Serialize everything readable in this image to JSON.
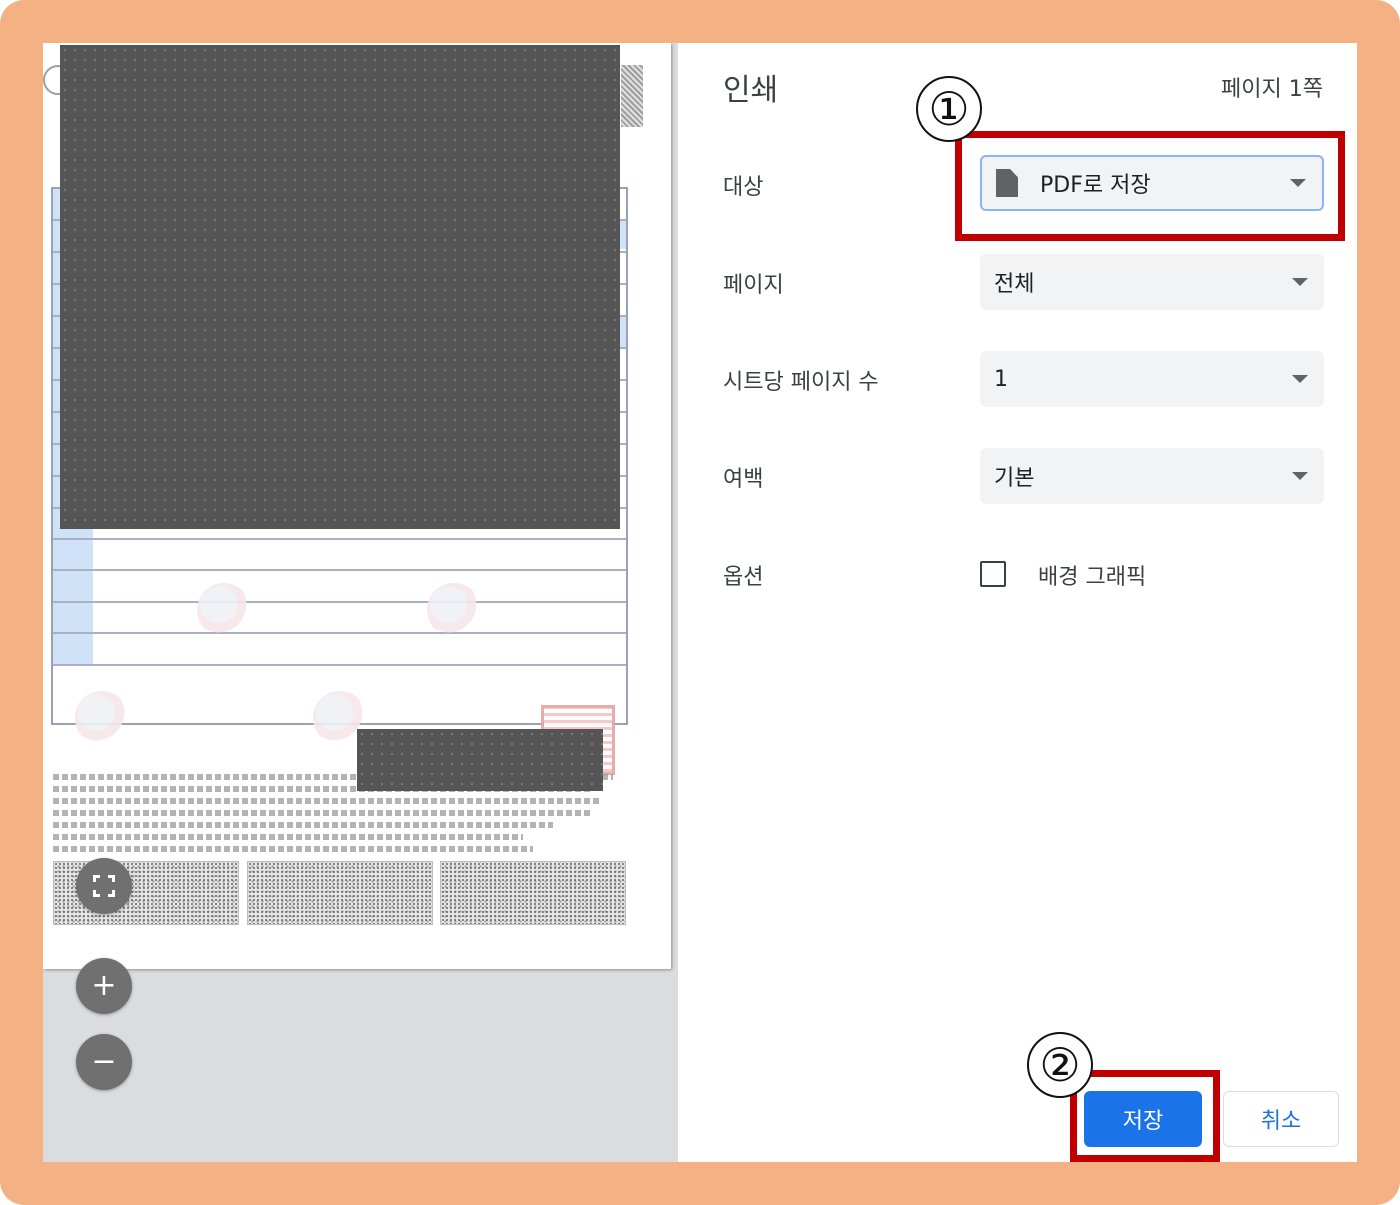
{
  "dialog": {
    "title": "인쇄",
    "page_count": "페이지 1쪽"
  },
  "settings": {
    "destination": {
      "label": "대상",
      "value": "PDF로 저장",
      "icon": "document-icon"
    },
    "pages": {
      "label": "페이지",
      "value": "전체"
    },
    "pages_per_sheet": {
      "label": "시트당 페이지 수",
      "value": "1"
    },
    "margins": {
      "label": "여백",
      "value": "기본"
    },
    "options": {
      "label": "옵션",
      "checkbox_label": "배경 그래픽",
      "checked": false
    }
  },
  "buttons": {
    "save": "저장",
    "cancel": "취소"
  },
  "preview_controls": {
    "fit_icon": "fit-to-page-icon",
    "zoom_in": "+",
    "zoom_out": "−"
  },
  "annotations": {
    "step1": "①",
    "step2": "②",
    "color": "#c00000"
  },
  "colors": {
    "frame": "#f4b183",
    "primary": "#1a73e8",
    "select_bg": "#f1f3f4"
  }
}
